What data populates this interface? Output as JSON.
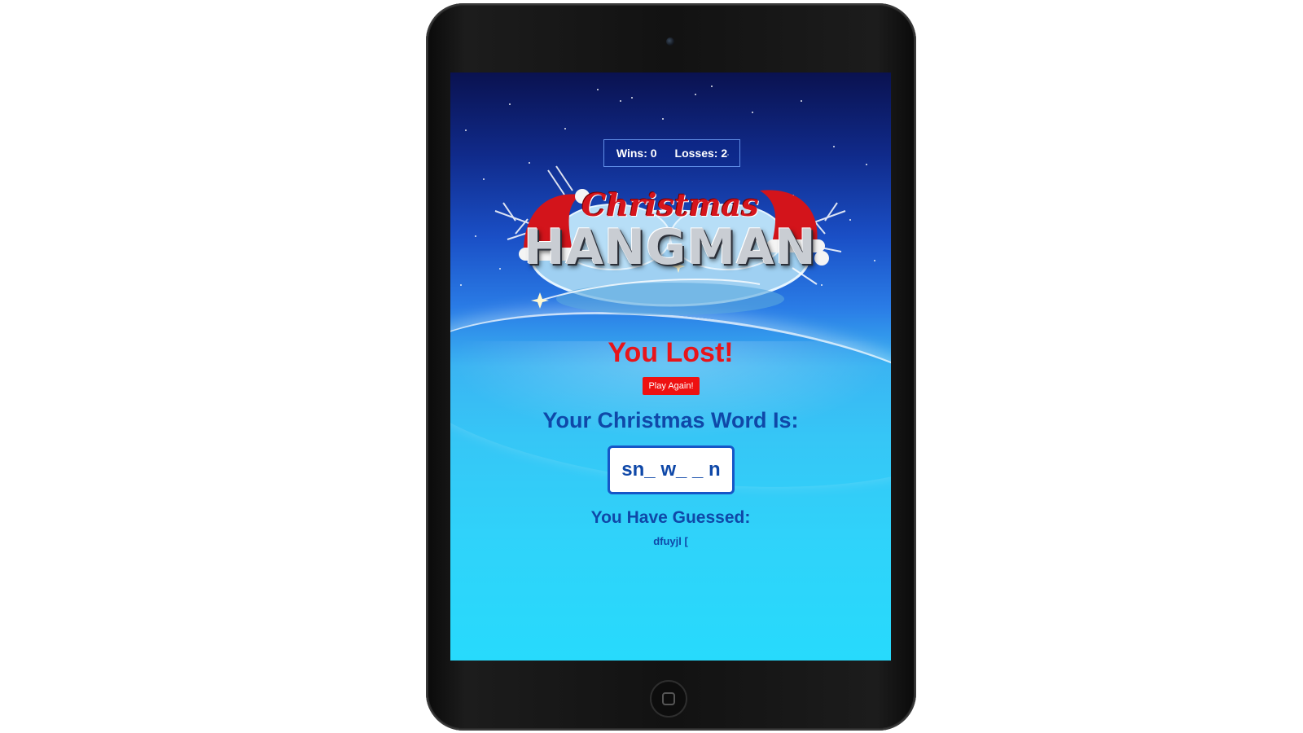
{
  "scoreboard": {
    "wins_label": "Wins: 0",
    "losses_label": "Losses: 2"
  },
  "logo": {
    "line1": "Christmas",
    "line2": "HANGMAN"
  },
  "game": {
    "result_message": "You Lost!",
    "play_again_label": "Play Again!",
    "word_heading": "Your Christmas Word Is:",
    "current_word": "sn_ w_ _ n",
    "guessed_heading": "You Have Guessed:",
    "guessed_letters": "dfuyjl ["
  },
  "colors": {
    "result_red": "#e8141a",
    "button_red": "#ee1111",
    "text_blue": "#0f48a8"
  },
  "icons": [
    "santa-hat-icon",
    "home-button-icon",
    "camera-icon"
  ]
}
